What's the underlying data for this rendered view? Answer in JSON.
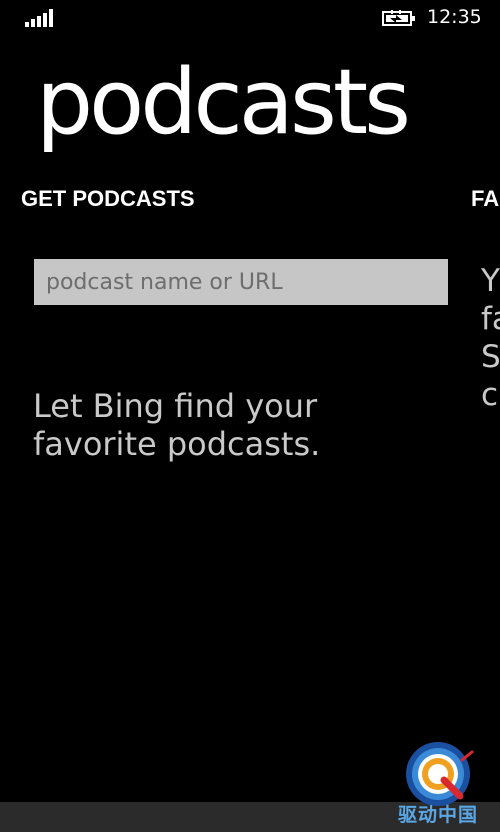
{
  "status_bar": {
    "signal_icon": "signal-strength-icon",
    "battery_icon": "battery-charging-icon",
    "time": "12:35"
  },
  "page": {
    "title": "podcasts"
  },
  "pivots": [
    {
      "label": "GET PODCASTS"
    },
    {
      "label": "FA"
    }
  ],
  "get_podcasts": {
    "search_placeholder": "podcast name or URL",
    "search_value": "",
    "bing_line1": "Let Bing find your",
    "bing_line2": "favorite podcasts."
  },
  "favorites_peek": {
    "lines": [
      "Y",
      "fa",
      "S",
      "c"
    ]
  },
  "watermark": {
    "logo_icon": "driver-china-logo-icon",
    "text": "驱动中国"
  },
  "colors": {
    "background": "#000000",
    "foreground": "#ffffff",
    "input_background": "#c6c6c6",
    "secondary_text": "#c9c9c9"
  }
}
